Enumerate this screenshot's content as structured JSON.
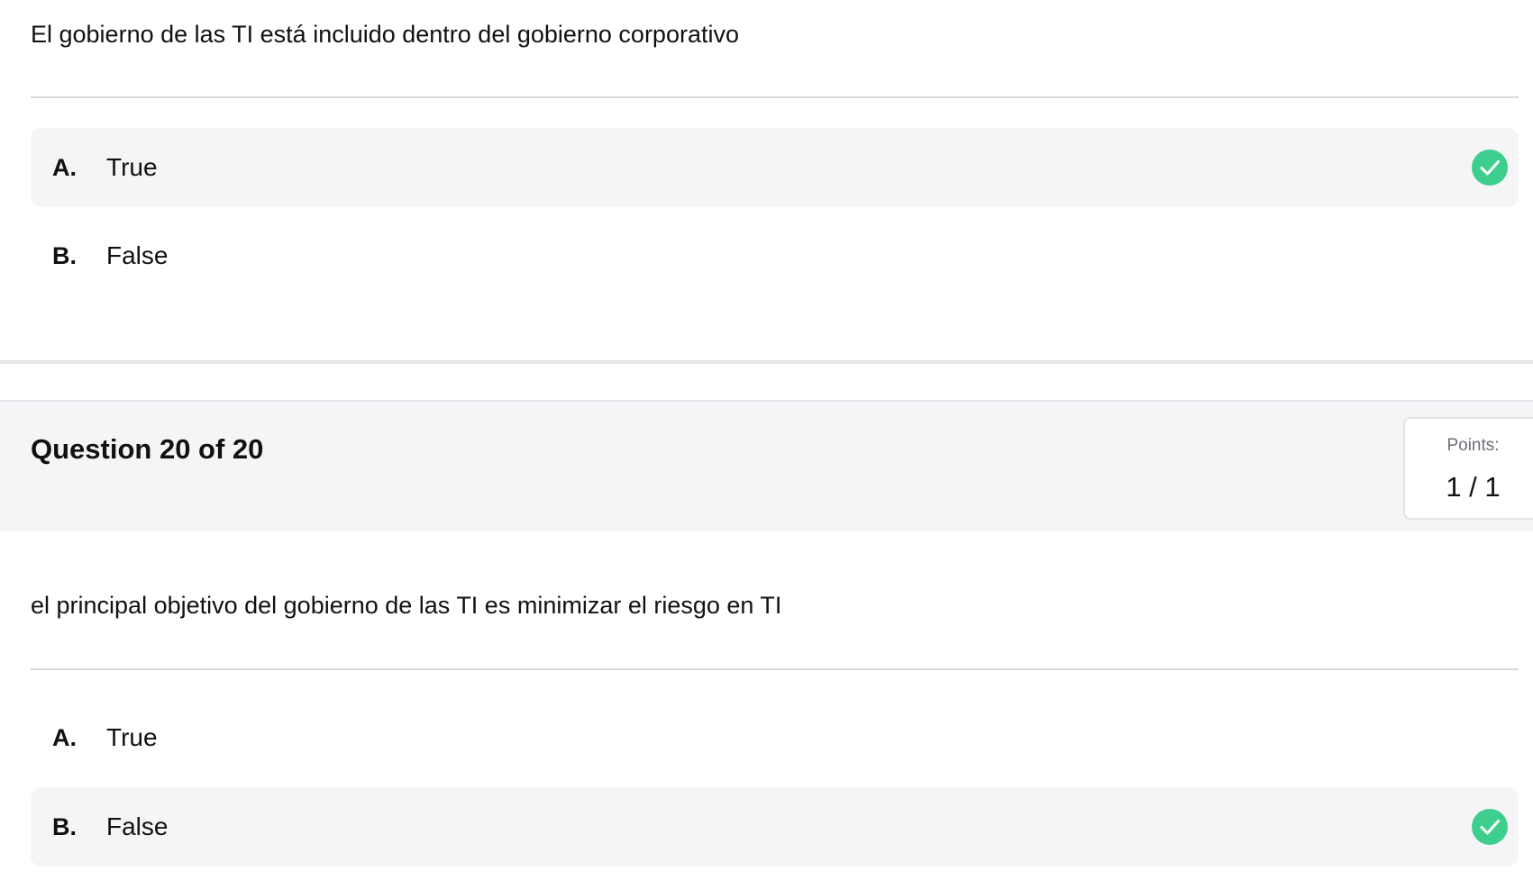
{
  "previous_question": {
    "text": "El gobierno de las TI está incluido dentro del gobierno corporativo",
    "options": [
      {
        "letter": "A.",
        "label": "True",
        "selected": true,
        "correct": true
      },
      {
        "letter": "B.",
        "label": "False",
        "selected": false,
        "correct": false
      }
    ]
  },
  "current_question": {
    "header": "Question 20 of 20",
    "points_label": "Points:",
    "points_value": "1 / 1",
    "text": "el principal objetivo del gobierno de las TI es minimizar el riesgo en TI",
    "options": [
      {
        "letter": "A.",
        "label": "True",
        "selected": false,
        "correct": false
      },
      {
        "letter": "B.",
        "label": "False",
        "selected": true,
        "correct": true
      }
    ]
  },
  "icons": {
    "check": "check-circle-icon"
  },
  "colors": {
    "check_green": "#3ecf8e",
    "selected_bg": "#f5f5f7",
    "header_bg": "#f4f5f7"
  }
}
